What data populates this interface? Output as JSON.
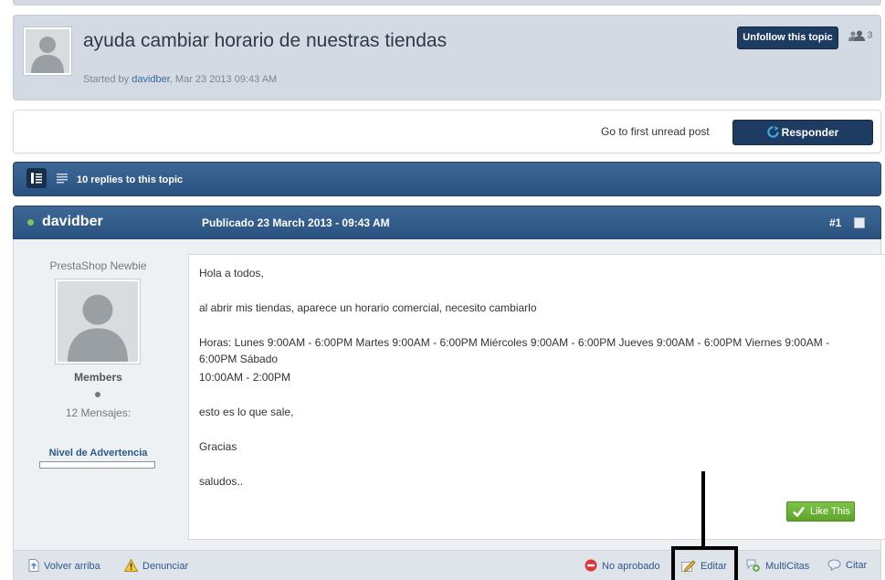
{
  "topic": {
    "title": "ayuda cambiar horario de nuestras tiendas",
    "started_prefix": "Started by ",
    "started_by": "davidber",
    "started_suffix": ", Mar 23 2013 09:43 AM",
    "unfollow_label": "Unfollow this topic",
    "followers_count": "3"
  },
  "actions": {
    "first_unread_label": "Go to first unread post",
    "reply_label": "Responder"
  },
  "replies": {
    "count_label": "10 replies to this topic"
  },
  "post": {
    "author": "davidber",
    "published": "Publicado 23 March 2013 - 09:43 AM",
    "number": "#1",
    "rank": "PrestaShop Newbie",
    "group": "Members",
    "post_count": "12 Mensajes:",
    "warning_label": "Nivel de Advertencia",
    "warning_level": 0,
    "body": [
      "Hola a todos,",
      "al abrir mis tiendas, aparece un horario comercial, necesito cambiarlo",
      "Horas: Lunes 9:00AM - 6:00PM Martes 9:00AM - 6:00PM Miércoles 9:00AM - 6:00PM Jueves 9:00AM - 6:00PM Viernes 9:00AM - 6:00PM Sábado",
      "10:00AM - 2:00PM",
      "esto es lo que sale,",
      "Gracias",
      "saludos.."
    ],
    "like_label": "Like This"
  },
  "footer": {
    "back_to_top": "Volver arriba",
    "report": "Denunciar",
    "not_approved": "No aprobado",
    "edit": "Editar",
    "multiquote": "MultiCitas",
    "quote": "Citar"
  },
  "icons": {
    "topic_avatar": "default-avatar-icon",
    "followers": "users-icon",
    "reply": "refresh-icon",
    "view_full": "list-view-icon",
    "view_compact": "compact-view-icon",
    "like": "checkmark-icon",
    "back_to_top": "page-up-icon",
    "report": "warning-icon",
    "not_approved": "no-entry-icon",
    "edit": "pencil-icon",
    "multiquote": "multiquote-icon",
    "quote": "speech-bubble-icon"
  },
  "colors": {
    "header_blue": "#2a5280",
    "button_navy": "#1e3c61",
    "link_blue": "#2b5a8c",
    "like_green": "#5ea52c",
    "online_green": "#7fc35b"
  }
}
